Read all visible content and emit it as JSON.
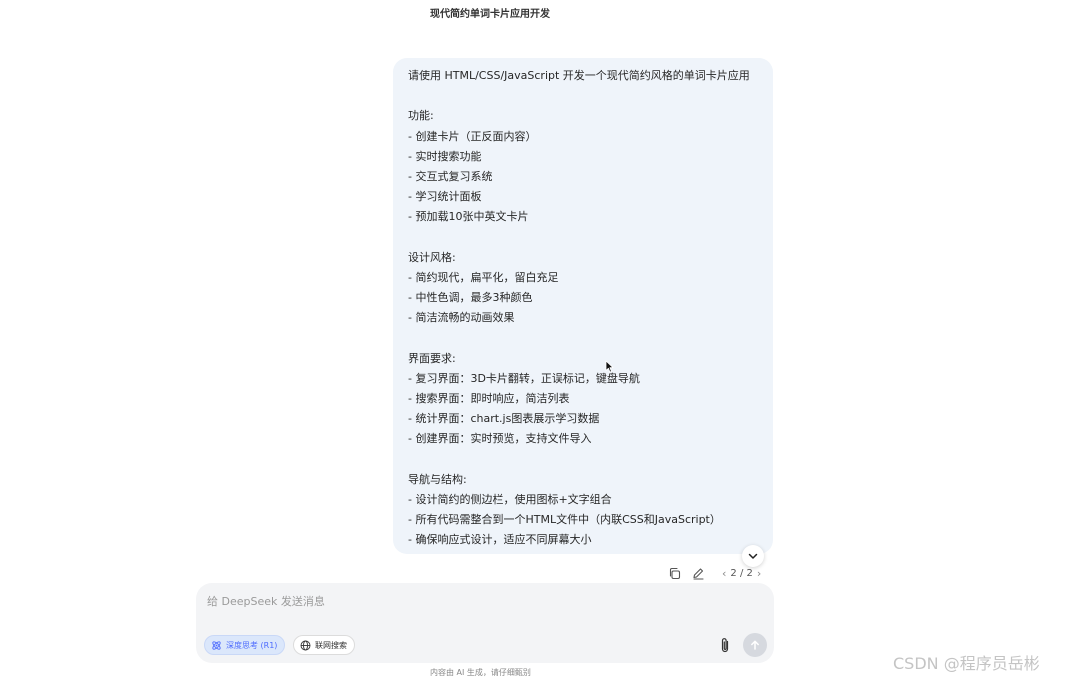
{
  "chat": {
    "title": "现代简约单词卡片应用开发"
  },
  "message": {
    "lines": [
      "请使用 HTML/CSS/JavaScript 开发一个现代简约风格的单词卡片应用",
      "",
      "功能:",
      "- 创建卡片（正反面内容）",
      "- 实时搜索功能",
      "- 交互式复习系统",
      "- 学习统计面板",
      "- 预加载10张中英文卡片",
      "",
      "设计风格:",
      "- 简约现代，扁平化，留白充足",
      "- 中性色调，最多3种颜色",
      "- 简洁流畅的动画效果",
      "",
      "界面要求:",
      "- 复习界面：3D卡片翻转，正误标记，键盘导航",
      "- 搜索界面：即时响应，简洁列表",
      "- 统计界面：chart.js图表展示学习数据",
      "- 创建界面：实时预览，支持文件导入",
      "",
      "导航与结构:",
      "- 设计简约的侧边栏，使用图标+文字组合",
      "- 所有代码需整合到一个HTML文件中（内联CSS和JavaScript）",
      "- 确保响应式设计，适应不同屏幕大小"
    ],
    "actions": {
      "copy_icon": "copy-icon",
      "edit_icon": "edit-icon",
      "page_indicator": "2 / 2",
      "prev_icon": "chevron-left-icon",
      "next_icon": "chevron-right-icon"
    }
  },
  "composer": {
    "placeholder": "给 DeepSeek 发送消息",
    "deep_think_label": "深度思考 (R1)",
    "web_search_label": "联网搜索",
    "deep_think_active": true,
    "web_search_active": false
  },
  "footer": {
    "disclaimer": "内容由 AI 生成，请仔细甄别"
  },
  "watermark": {
    "text": "CSDN @程序员岳彬"
  },
  "colors": {
    "bubble_bg": "#eff4fa",
    "accent": "#4d6bfe",
    "composer_bg": "#f3f4f6",
    "send_disabled": "#d6d9df"
  }
}
